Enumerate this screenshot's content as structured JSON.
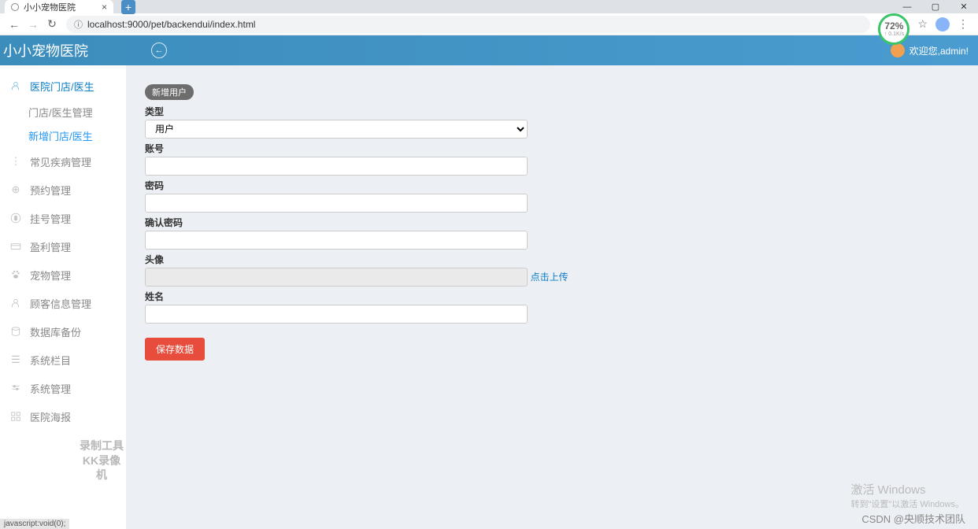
{
  "browser": {
    "tab_title": "小小宠物医院",
    "url": "localhost:9000/pet/backendui/index.html",
    "speed_pct": "72%",
    "speed_rate": "↑ 0.1K/s"
  },
  "header": {
    "app_title": "小小宠物医院",
    "welcome": "欢迎您,admin!"
  },
  "sidebar": {
    "items": [
      {
        "label": "医院门店/医生",
        "icon": "user-icon",
        "active": true
      },
      {
        "label": "常见疾病管理",
        "icon": "dots-icon"
      },
      {
        "label": "预约管理",
        "icon": "plus-circle-icon"
      },
      {
        "label": "挂号管理",
        "icon": "money-icon"
      },
      {
        "label": "盈利管理",
        "icon": "card-icon"
      },
      {
        "label": "宠物管理",
        "icon": "paw-icon"
      },
      {
        "label": "顾客信息管理",
        "icon": "user-icon"
      },
      {
        "label": "数据库备份",
        "icon": "db-icon"
      },
      {
        "label": "系统栏目",
        "icon": "list-icon"
      },
      {
        "label": "系统管理",
        "icon": "settings-icon"
      },
      {
        "label": "医院海报",
        "icon": "grid-icon"
      }
    ],
    "sub_items": [
      {
        "label": "门店/医生管理",
        "selected": false
      },
      {
        "label": "新增门店/医生",
        "selected": true
      }
    ]
  },
  "form": {
    "badge": "新增用户",
    "type_label": "类型",
    "type_value": "用户",
    "account_label": "账号",
    "account_value": "",
    "password_label": "密码",
    "password_value": "",
    "confirm_label": "确认密码",
    "confirm_value": "",
    "avatar_label": "头像",
    "avatar_value": "",
    "upload_text": "点击上传",
    "name_label": "姓名",
    "name_value": "",
    "save_button": "保存数据"
  },
  "watermarks": {
    "recorder_line1": "录制工具",
    "recorder_line2": "KK录像机",
    "activate_title": "激活 Windows",
    "activate_sub": "转到\"设置\"以激活 Windows。",
    "csdn": "CSDN @央顺技术团队",
    "status": "javascript:void(0);"
  }
}
